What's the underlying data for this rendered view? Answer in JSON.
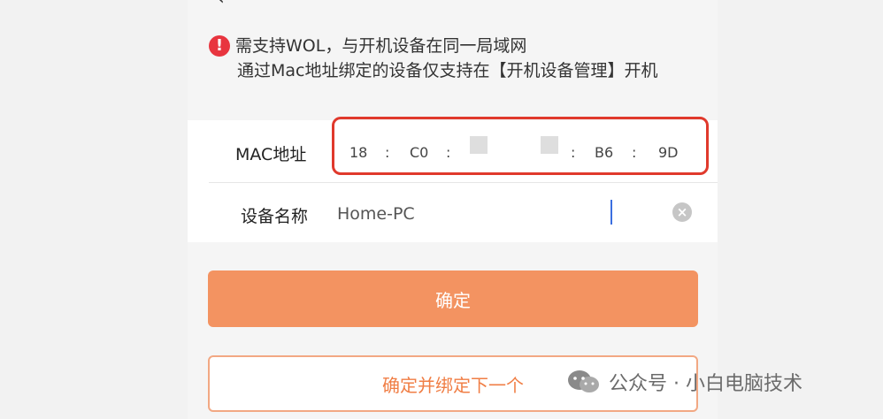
{
  "notice": {
    "line1": "需支持WOL，与开机设备在同一局域网",
    "line2": "通过Mac地址绑定的设备仅支持在【开机设备管理】开机"
  },
  "form": {
    "mac_label": "MAC地址",
    "mac_segments": [
      "18",
      "C0",
      "",
      "",
      "B6",
      "9D"
    ],
    "mac_separator": ":",
    "name_label": "设备名称",
    "name_value": "Home-PC"
  },
  "buttons": {
    "confirm": "确定",
    "confirm_and_next": "确定并绑定下一个"
  },
  "watermark": {
    "text": "公众号 · 小白电脑技术"
  },
  "colors": {
    "primary": "#f39361",
    "warn": "#e8353f",
    "highlight_box": "#e0392c"
  }
}
